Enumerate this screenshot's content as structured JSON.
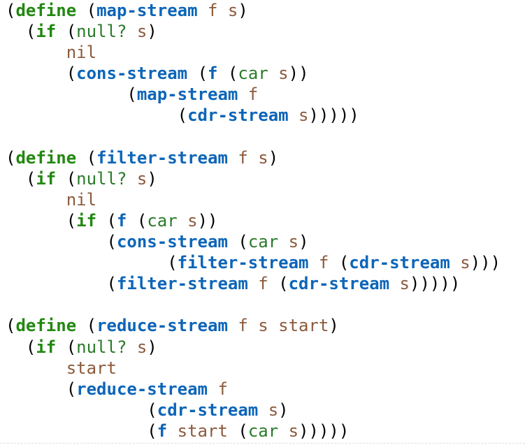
{
  "code": {
    "language": "scheme",
    "colors": {
      "paren": "#000000",
      "keyword": "#228811",
      "function": "#0d65b8",
      "builtin": "#2a7a2a",
      "variable": "#8b5a3c"
    },
    "lines": [
      [
        {
          "t": "(",
          "k": "paren"
        },
        {
          "t": "define",
          "k": "kw"
        },
        {
          "t": " ",
          "k": "space"
        },
        {
          "t": "(",
          "k": "paren"
        },
        {
          "t": "map-stream",
          "k": "fn"
        },
        {
          "t": " f s",
          "k": "var"
        },
        {
          "t": ")",
          "k": "paren"
        }
      ],
      [
        {
          "t": "  ",
          "k": "space"
        },
        {
          "t": "(",
          "k": "paren"
        },
        {
          "t": "if",
          "k": "kw"
        },
        {
          "t": " ",
          "k": "space"
        },
        {
          "t": "(",
          "k": "paren"
        },
        {
          "t": "null?",
          "k": "builtin"
        },
        {
          "t": " s",
          "k": "var"
        },
        {
          "t": ")",
          "k": "paren"
        }
      ],
      [
        {
          "t": "      ",
          "k": "space"
        },
        {
          "t": "nil",
          "k": "var"
        }
      ],
      [
        {
          "t": "      ",
          "k": "space"
        },
        {
          "t": "(",
          "k": "paren"
        },
        {
          "t": "cons-stream",
          "k": "fn"
        },
        {
          "t": " ",
          "k": "space"
        },
        {
          "t": "(",
          "k": "paren"
        },
        {
          "t": "f",
          "k": "fn"
        },
        {
          "t": " ",
          "k": "space"
        },
        {
          "t": "(",
          "k": "paren"
        },
        {
          "t": "car",
          "k": "builtin"
        },
        {
          "t": " s",
          "k": "var"
        },
        {
          "t": "))",
          "k": "paren"
        }
      ],
      [
        {
          "t": "            ",
          "k": "space"
        },
        {
          "t": "(",
          "k": "paren"
        },
        {
          "t": "map-stream",
          "k": "fn"
        },
        {
          "t": " f",
          "k": "var"
        }
      ],
      [
        {
          "t": "                 ",
          "k": "space"
        },
        {
          "t": "(",
          "k": "paren"
        },
        {
          "t": "cdr-stream",
          "k": "fn"
        },
        {
          "t": " s",
          "k": "var"
        },
        {
          "t": ")))))",
          "k": "paren"
        }
      ],
      [],
      [
        {
          "t": "(",
          "k": "paren"
        },
        {
          "t": "define",
          "k": "kw"
        },
        {
          "t": " ",
          "k": "space"
        },
        {
          "t": "(",
          "k": "paren"
        },
        {
          "t": "filter-stream",
          "k": "fn"
        },
        {
          "t": " f s",
          "k": "var"
        },
        {
          "t": ")",
          "k": "paren"
        }
      ],
      [
        {
          "t": "  ",
          "k": "space"
        },
        {
          "t": "(",
          "k": "paren"
        },
        {
          "t": "if",
          "k": "kw"
        },
        {
          "t": " ",
          "k": "space"
        },
        {
          "t": "(",
          "k": "paren"
        },
        {
          "t": "null?",
          "k": "builtin"
        },
        {
          "t": " s",
          "k": "var"
        },
        {
          "t": ")",
          "k": "paren"
        }
      ],
      [
        {
          "t": "      ",
          "k": "space"
        },
        {
          "t": "nil",
          "k": "var"
        }
      ],
      [
        {
          "t": "      ",
          "k": "space"
        },
        {
          "t": "(",
          "k": "paren"
        },
        {
          "t": "if",
          "k": "kw"
        },
        {
          "t": " ",
          "k": "space"
        },
        {
          "t": "(",
          "k": "paren"
        },
        {
          "t": "f",
          "k": "fn"
        },
        {
          "t": " ",
          "k": "space"
        },
        {
          "t": "(",
          "k": "paren"
        },
        {
          "t": "car",
          "k": "builtin"
        },
        {
          "t": " s",
          "k": "var"
        },
        {
          "t": "))",
          "k": "paren"
        }
      ],
      [
        {
          "t": "          ",
          "k": "space"
        },
        {
          "t": "(",
          "k": "paren"
        },
        {
          "t": "cons-stream",
          "k": "fn"
        },
        {
          "t": " ",
          "k": "space"
        },
        {
          "t": "(",
          "k": "paren"
        },
        {
          "t": "car",
          "k": "builtin"
        },
        {
          "t": " s",
          "k": "var"
        },
        {
          "t": ")",
          "k": "paren"
        }
      ],
      [
        {
          "t": "                ",
          "k": "space"
        },
        {
          "t": "(",
          "k": "paren"
        },
        {
          "t": "filter-stream",
          "k": "fn"
        },
        {
          "t": " f ",
          "k": "var"
        },
        {
          "t": "(",
          "k": "paren"
        },
        {
          "t": "cdr-stream",
          "k": "fn"
        },
        {
          "t": " s",
          "k": "var"
        },
        {
          "t": ")))",
          "k": "paren"
        }
      ],
      [
        {
          "t": "          ",
          "k": "space"
        },
        {
          "t": "(",
          "k": "paren"
        },
        {
          "t": "filter-stream",
          "k": "fn"
        },
        {
          "t": " f ",
          "k": "var"
        },
        {
          "t": "(",
          "k": "paren"
        },
        {
          "t": "cdr-stream",
          "k": "fn"
        },
        {
          "t": " s",
          "k": "var"
        },
        {
          "t": ")))))",
          "k": "paren"
        }
      ],
      [],
      [
        {
          "t": "(",
          "k": "paren"
        },
        {
          "t": "define",
          "k": "kw"
        },
        {
          "t": " ",
          "k": "space"
        },
        {
          "t": "(",
          "k": "paren"
        },
        {
          "t": "reduce-stream",
          "k": "fn"
        },
        {
          "t": " f s start",
          "k": "var"
        },
        {
          "t": ")",
          "k": "paren"
        }
      ],
      [
        {
          "t": "  ",
          "k": "space"
        },
        {
          "t": "(",
          "k": "paren"
        },
        {
          "t": "if",
          "k": "kw"
        },
        {
          "t": " ",
          "k": "space"
        },
        {
          "t": "(",
          "k": "paren"
        },
        {
          "t": "null?",
          "k": "builtin"
        },
        {
          "t": " s",
          "k": "var"
        },
        {
          "t": ")",
          "k": "paren"
        }
      ],
      [
        {
          "t": "      ",
          "k": "space"
        },
        {
          "t": "start",
          "k": "var"
        }
      ],
      [
        {
          "t": "      ",
          "k": "space"
        },
        {
          "t": "(",
          "k": "paren"
        },
        {
          "t": "reduce-stream",
          "k": "fn"
        },
        {
          "t": " f",
          "k": "var"
        }
      ],
      [
        {
          "t": "              ",
          "k": "space"
        },
        {
          "t": "(",
          "k": "paren"
        },
        {
          "t": "cdr-stream",
          "k": "fn"
        },
        {
          "t": " s",
          "k": "var"
        },
        {
          "t": ")",
          "k": "paren"
        }
      ],
      [
        {
          "t": "              ",
          "k": "space"
        },
        {
          "t": "(",
          "k": "paren"
        },
        {
          "t": "f",
          "k": "fn"
        },
        {
          "t": " start ",
          "k": "var"
        },
        {
          "t": "(",
          "k": "paren"
        },
        {
          "t": "car",
          "k": "builtin"
        },
        {
          "t": " s",
          "k": "var"
        },
        {
          "t": ")))))",
          "k": "paren"
        }
      ]
    ]
  }
}
